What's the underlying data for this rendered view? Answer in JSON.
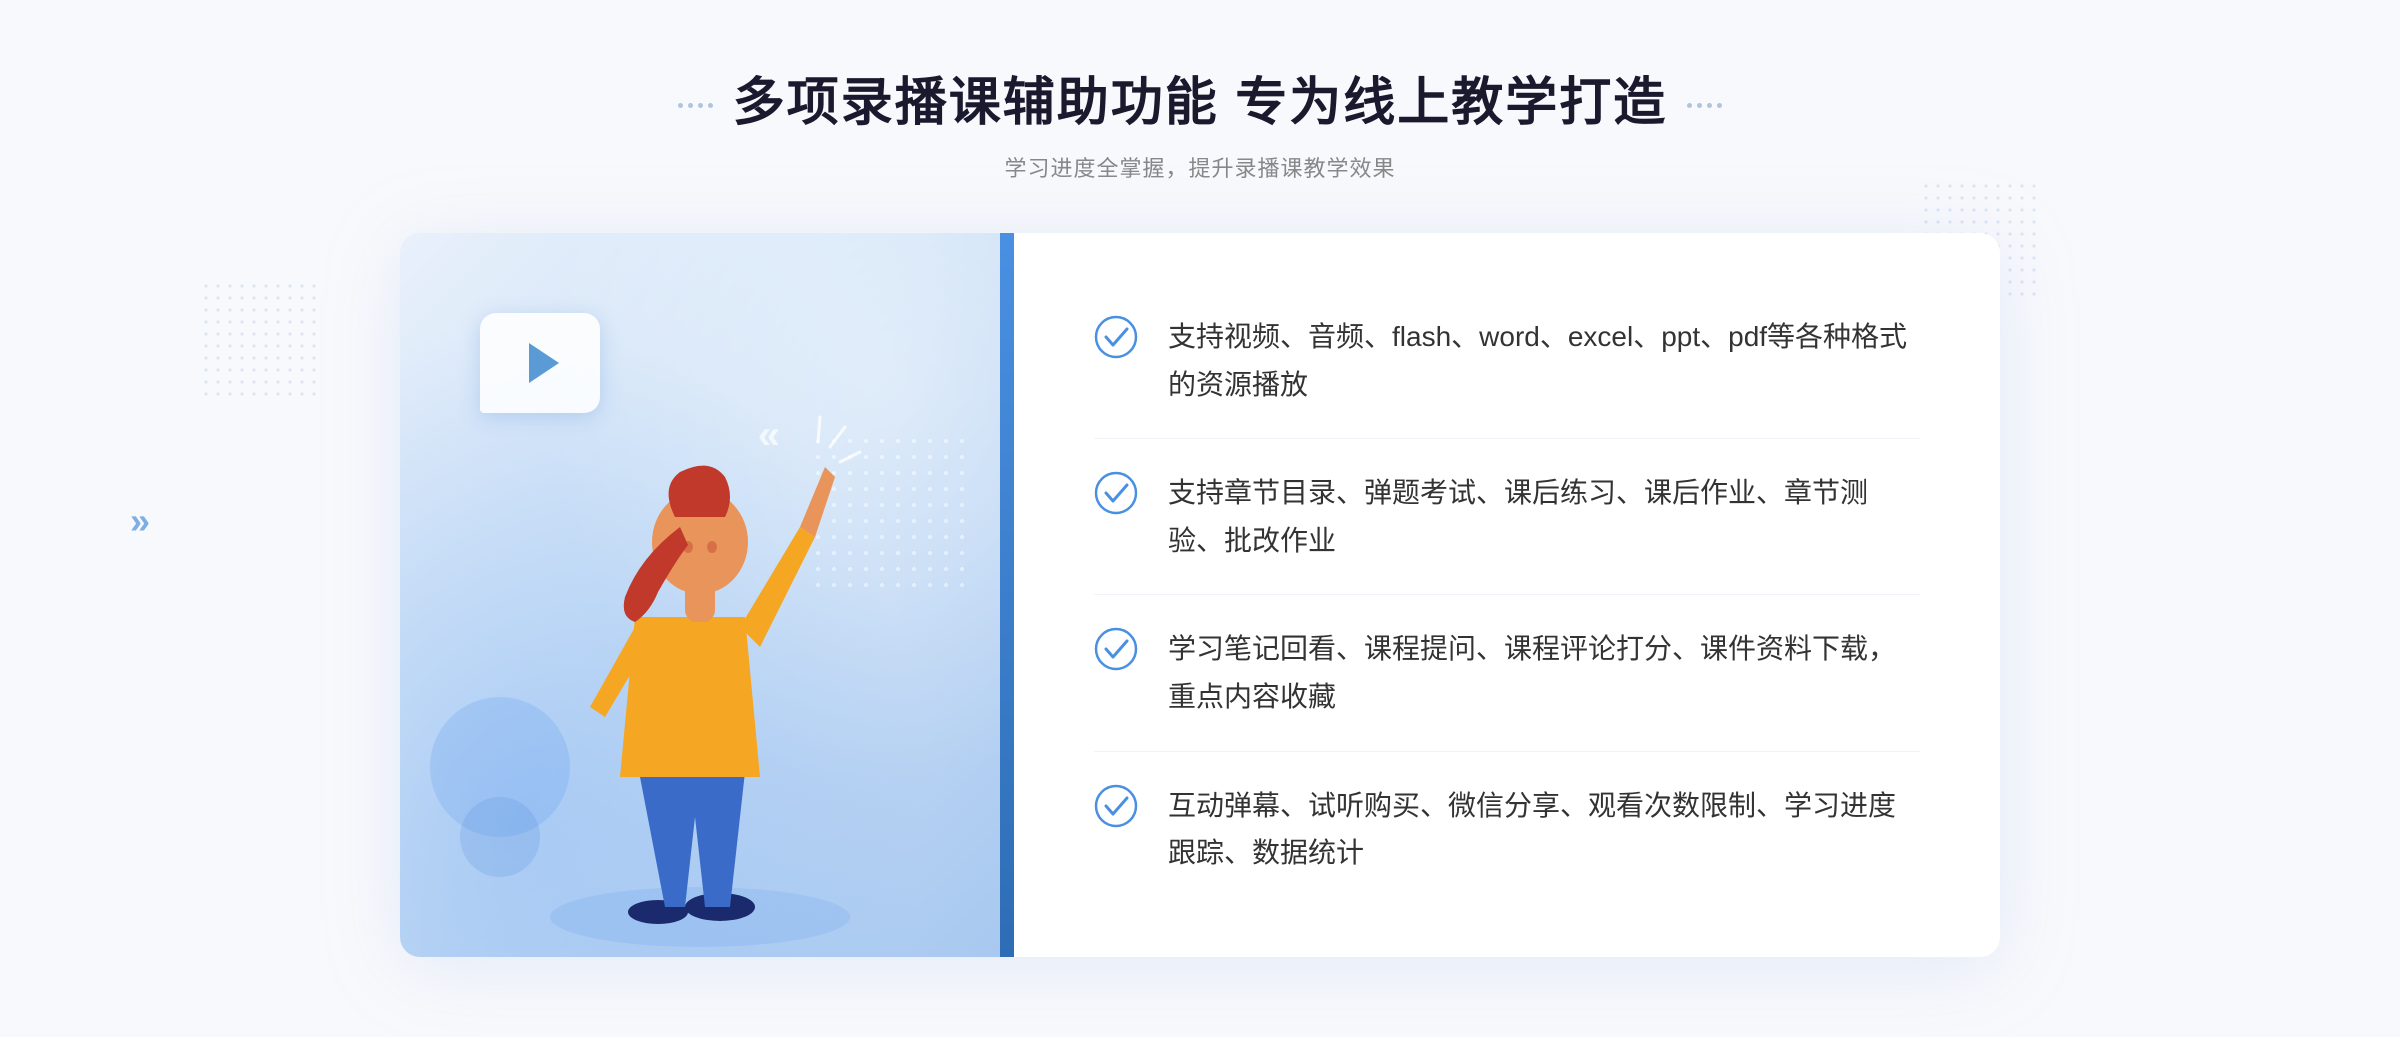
{
  "header": {
    "main_title": "多项录播课辅助功能 专为线上教学打造",
    "sub_title": "学习进度全掌握，提升录播课教学效果"
  },
  "features": [
    {
      "id": "feature-1",
      "text": "支持视频、音频、flash、word、excel、ppt、pdf等各种格式的资源播放"
    },
    {
      "id": "feature-2",
      "text": "支持章节目录、弹题考试、课后练习、课后作业、章节测验、批改作业"
    },
    {
      "id": "feature-3",
      "text": "学习笔记回看、课程提问、课程评论打分、课件资料下载，重点内容收藏"
    },
    {
      "id": "feature-4",
      "text": "互动弹幕、试听购买、微信分享、观看次数限制、学习进度跟踪、数据统计"
    }
  ],
  "colors": {
    "primary_blue": "#4a90e2",
    "text_dark": "#1a1a2e",
    "text_gray": "#888888",
    "text_body": "#333333",
    "bg_light": "#f8f9fc"
  },
  "decorators": {
    "left_chevron": "»",
    "right_dots_count": 4
  }
}
